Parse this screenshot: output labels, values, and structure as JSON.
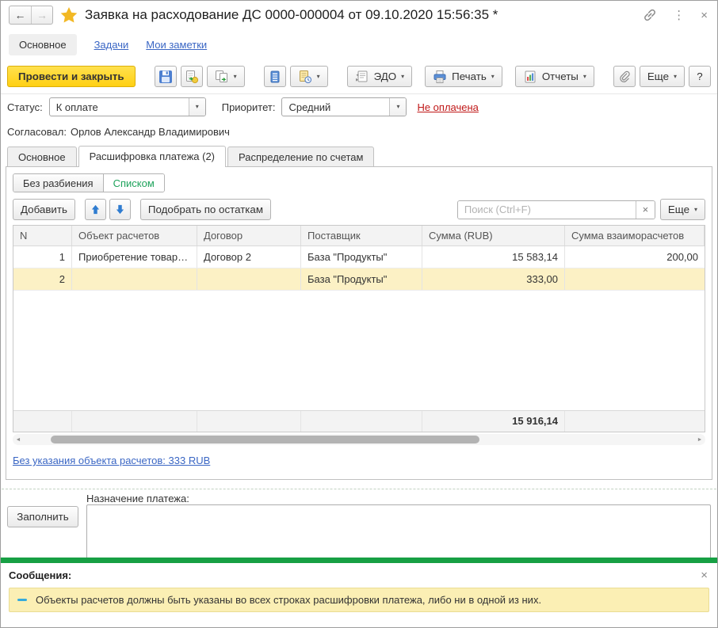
{
  "icons": {
    "back": "←",
    "forward": "→",
    "kebab": "⋮",
    "close": "×",
    "caret": "▾",
    "clear": "×",
    "left_scroll": "◄",
    "right_scroll": "►",
    "named": [
      "star-icon",
      "link-icon",
      "save-icon",
      "post-icon",
      "create-based-on-icon",
      "register-records-icon",
      "document-history-icon",
      "edo-icon",
      "print-icon",
      "reports-icon",
      "paperclip-icon",
      "arrow-up-icon",
      "arrow-down-icon",
      "dash-icon"
    ]
  },
  "colors": {
    "primary_button": "#ffd013",
    "green_bar": "#17a044",
    "selected_row": "#fcf1c5",
    "message_bg": "#fbefb4",
    "link": "#3a66c4",
    "red_link": "#c01818",
    "toggle_active_text": "#1fa35c"
  },
  "titlebar": {
    "title": "Заявка на расходование ДС 0000-000004 от 09.10.2020 15:56:35 *"
  },
  "nav": {
    "main": "Основное",
    "tasks": "Задачи",
    "notes": "Мои заметки"
  },
  "toolbar": {
    "post_close": "Провести и закрыть",
    "edo_label": "ЭДО",
    "print_label": "Печать",
    "reports_label": "Отчеты",
    "more_label": "Еще",
    "help_label": "?"
  },
  "status": {
    "label": "Статус:",
    "value": "К оплате",
    "priority_label": "Приоритет:",
    "priority_value": "Средний",
    "not_paid": "Не оплачена"
  },
  "approved": {
    "label": "Согласовал:",
    "value": "Орлов Александр Владимирович"
  },
  "tabs": {
    "main": "Основное",
    "decode": "Расшифровка платежа (2)",
    "accounts": "Распределение по счетам"
  },
  "toggle": {
    "no_split": "Без разбиения",
    "list": "Списком"
  },
  "table_toolbar": {
    "add": "Добавить",
    "pick": "Подобрать по остаткам",
    "search_placeholder": "Поиск (Ctrl+F)",
    "more": "Еще"
  },
  "table": {
    "columns": [
      "N",
      "Объект расчетов",
      "Договор",
      "Поставщик",
      "Сумма (RUB)",
      "Сумма взаиморасчетов"
    ],
    "rows": [
      {
        "n": "1",
        "object": "Приобретение товаро...",
        "contract": "Договор 2",
        "supplier": "База \"Продукты\"",
        "sum": "15 583,14",
        "mutual": "200,00"
      },
      {
        "n": "2",
        "object": "",
        "contract": "",
        "supplier": "База \"Продукты\"",
        "sum": "333,00",
        "mutual": ""
      }
    ],
    "total_sum": "15 916,14"
  },
  "link_no_object": "Без указания объекта расчетов: 333 RUB",
  "bottom": {
    "fill": "Заполнить",
    "purpose_label": "Назначение платежа:"
  },
  "messages": {
    "header": "Сообщения:",
    "items": [
      {
        "text": "Объекты расчетов должны быть указаны во всех строках расшифровки платежа, либо ни в одной из них."
      }
    ]
  }
}
